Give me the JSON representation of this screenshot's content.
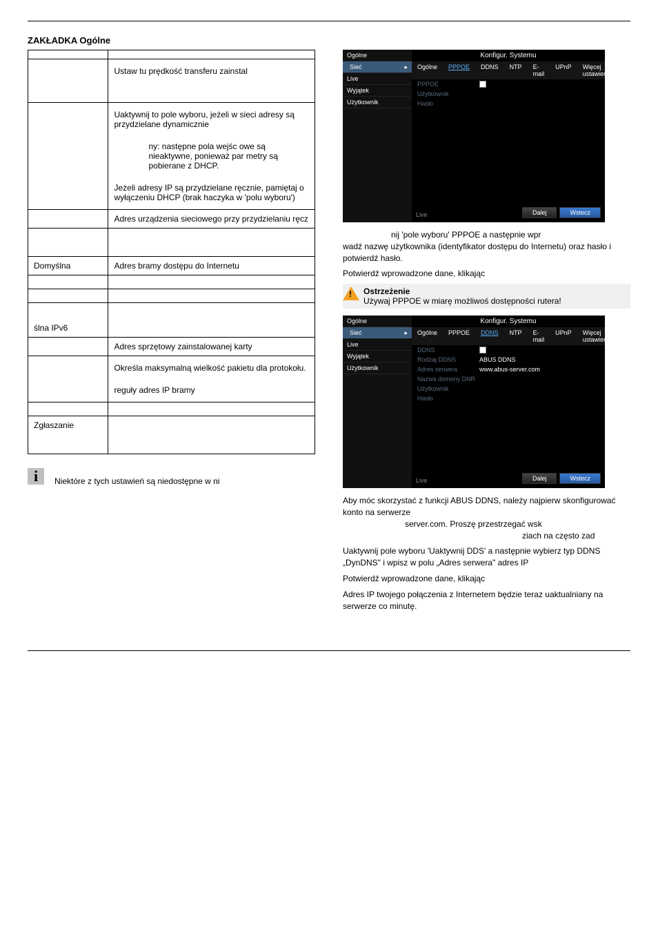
{
  "heading": "ZAKŁADKA Ogólne",
  "table": {
    "r1_desc": "Ustaw tu prędkość transferu zainstal",
    "r2_desc": "Uaktywnij to pole wyboru, jeżeli w sieci adresy są przydzielane dynamicznie",
    "r2_sub": "ny: następne pola wejśc owe są nieaktywne, ponieważ par metry są pobierane z DHCP.",
    "r2_more": "Jeżeli adresy IP są przydzielane ręcznie, pamiętaj o wyłączeniu DHCP (brak haczyka w 'polu wyboru')",
    "r3_desc": "Adres urządzenia sieciowego przy przydzielaniu ręcz",
    "r4_empty": "",
    "r5_name": "Domyślna",
    "r5_desc": "Adres bramy dostępu do Internetu",
    "r6_empty": "",
    "r6b_empty": "",
    "r7_name": "ślna IPv6",
    "r7_desc": "",
    "r8_desc": "Adres sprzętowy zainstalowanej karty",
    "r9_desc": "Określa maksymalną wielkość pakietu dla protokołu.",
    "r10_desc": "reguły adres IP bramy",
    "r11_empty": "",
    "r12_name": "Zgłaszanie",
    "r12_desc": ""
  },
  "info_note": "Niektóre z tych ustawień są niedostępne w ni",
  "sidebar_items": [
    "Ogólne",
    "Sieć",
    "Live",
    "Wyjątek",
    "Użytkownik"
  ],
  "screenshot_title": "Konfigur. Systemu",
  "tabs": [
    "Ogólne",
    "PPPOE",
    "DDNS",
    "NTP",
    "E-mail",
    "UPnP",
    "Więcej ustawień"
  ],
  "pppoe": {
    "section": "PPPOE",
    "fields": [
      "Użytkownik",
      "Hasło"
    ]
  },
  "ddns": {
    "section": "DDNS",
    "fields": [
      "Rodzaj DDNS",
      "Adres serwera",
      "Nazwa domeny DNR",
      "Użytkownik",
      "Hasło"
    ],
    "val_type": "ABUS DDNS",
    "val_server": "www.abus-server.com"
  },
  "btn_dalej": "Dalej",
  "btn_wstecz": "Wstecz",
  "footer_live": "Live",
  "right_p1_a": "nij 'pole wyboru' PPPOE a następnie wpr",
  "right_p1_b": "wadź nazwę użytkownika (identyfikator dostępu do Internetu) oraz hasło i potwierdź hasło.",
  "right_p2": "Potwierdź wprowadzone dane, klikając",
  "warn_title": "Ostrzeżenie",
  "warn_body": "Używaj PPPOE w miarę możliwoś dostępności rutera!",
  "ddns_p1a": "Aby móc skorzystać z funkcji ABUS DDNS, należy najpierw skonfigurować konto na serwerze",
  "ddns_p1b": "server.com.  Proszę przestrzegać wsk",
  "ddns_p1c": "ziach na często zad",
  "ddns_p2": "Uaktywnij pole wyboru 'Uaktywnij DDS' a następnie wybierz typ DDNS „DynDNS\" i wpisz w polu „Adres serwera\" adres IP",
  "ddns_link_placeholder": "                              ",
  "ddns_p3": "Potwierdź wprowadzone dane, klikając",
  "ddns_p4": "Adres IP twojego połączenia z Internetem będzie teraz uaktualniany na serwerze co minutę."
}
